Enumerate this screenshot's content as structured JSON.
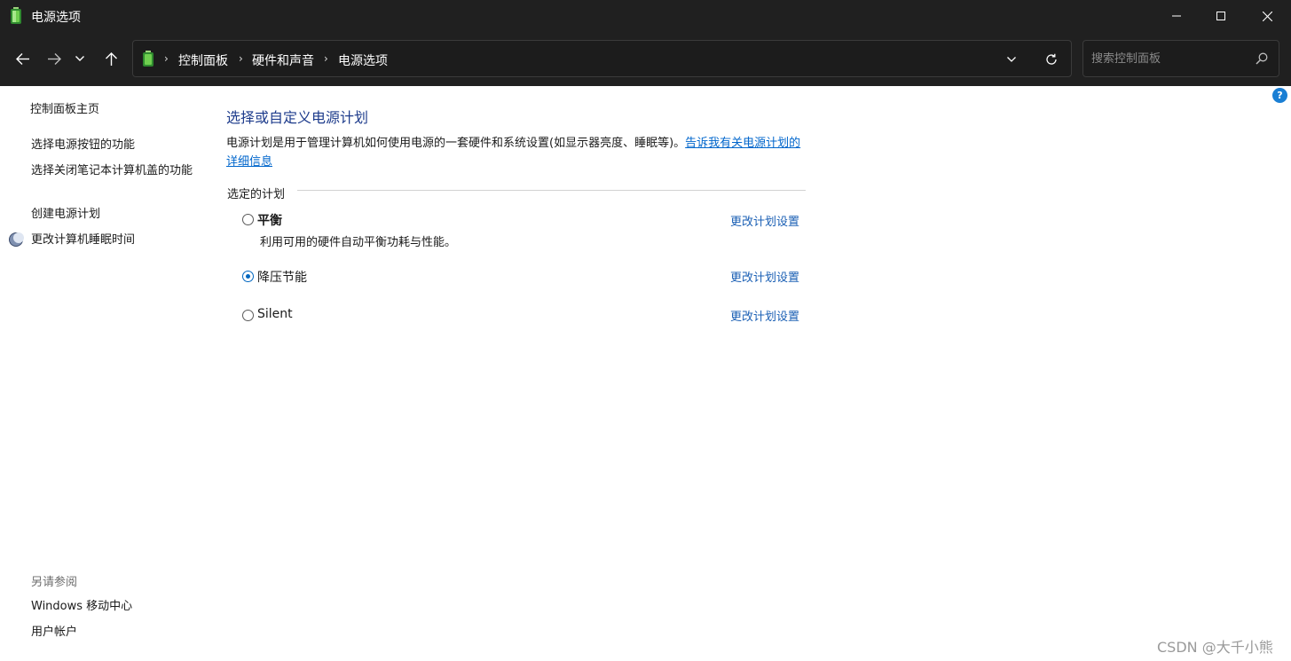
{
  "window": {
    "title": "电源选项",
    "icon": "battery-icon",
    "controls": [
      "minimize-icon",
      "maximize-icon",
      "close-icon"
    ]
  },
  "address": {
    "breadcrumbs": [
      "控制面板",
      "硬件和声音",
      "电源选项"
    ],
    "search_placeholder": "搜索控制面板"
  },
  "sidebar": {
    "home": "控制面板主页",
    "items": [
      "选择电源按钮的功能",
      "选择关闭笔记本计算机盖的功能",
      "创建电源计划",
      "更改计算机睡眠时间"
    ],
    "see_also_heading": "另请参阅",
    "see_also": [
      "Windows 移动中心",
      "用户帐户"
    ]
  },
  "main": {
    "heading": "选择或自定义电源计划",
    "description": "电源计划是用于管理计算机如何使用电源的一套硬件和系统设置(如显示器亮度、睡眠等)。",
    "description_link": "告诉我有关电源计划的详细信息",
    "section_label": "选定的计划",
    "plans": [
      {
        "name": "平衡",
        "description": "利用可用的硬件自动平衡功耗与性能。",
        "selected": false,
        "bold": true,
        "change_link": "更改计划设置"
      },
      {
        "name": "降压节能",
        "description": "",
        "selected": true,
        "bold": false,
        "change_link": "更改计划设置"
      },
      {
        "name": "Silent",
        "description": "",
        "selected": false,
        "bold": false,
        "change_link": "更改计划设置"
      }
    ]
  },
  "watermark": "CSDN @大千小熊",
  "colors": {
    "titlebar_bg": "#202020",
    "heading": "#1e3c8c",
    "link": "#1a5fb4",
    "radio_accent": "#0067c0"
  }
}
